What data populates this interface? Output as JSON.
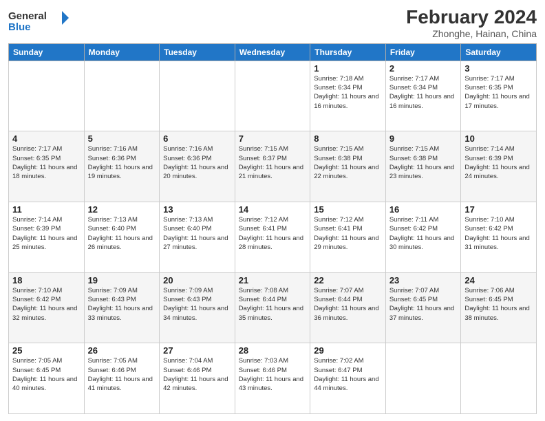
{
  "header": {
    "logo_general": "General",
    "logo_blue": "Blue",
    "title": "February 2024",
    "location": "Zhonghe, Hainan, China"
  },
  "days_of_week": [
    "Sunday",
    "Monday",
    "Tuesday",
    "Wednesday",
    "Thursday",
    "Friday",
    "Saturday"
  ],
  "weeks": [
    [
      {
        "day": "",
        "info": ""
      },
      {
        "day": "",
        "info": ""
      },
      {
        "day": "",
        "info": ""
      },
      {
        "day": "",
        "info": ""
      },
      {
        "day": "1",
        "info": "Sunrise: 7:18 AM\nSunset: 6:34 PM\nDaylight: 11 hours and 16 minutes."
      },
      {
        "day": "2",
        "info": "Sunrise: 7:17 AM\nSunset: 6:34 PM\nDaylight: 11 hours and 16 minutes."
      },
      {
        "day": "3",
        "info": "Sunrise: 7:17 AM\nSunset: 6:35 PM\nDaylight: 11 hours and 17 minutes."
      }
    ],
    [
      {
        "day": "4",
        "info": "Sunrise: 7:17 AM\nSunset: 6:35 PM\nDaylight: 11 hours and 18 minutes."
      },
      {
        "day": "5",
        "info": "Sunrise: 7:16 AM\nSunset: 6:36 PM\nDaylight: 11 hours and 19 minutes."
      },
      {
        "day": "6",
        "info": "Sunrise: 7:16 AM\nSunset: 6:36 PM\nDaylight: 11 hours and 20 minutes."
      },
      {
        "day": "7",
        "info": "Sunrise: 7:15 AM\nSunset: 6:37 PM\nDaylight: 11 hours and 21 minutes."
      },
      {
        "day": "8",
        "info": "Sunrise: 7:15 AM\nSunset: 6:38 PM\nDaylight: 11 hours and 22 minutes."
      },
      {
        "day": "9",
        "info": "Sunrise: 7:15 AM\nSunset: 6:38 PM\nDaylight: 11 hours and 23 minutes."
      },
      {
        "day": "10",
        "info": "Sunrise: 7:14 AM\nSunset: 6:39 PM\nDaylight: 11 hours and 24 minutes."
      }
    ],
    [
      {
        "day": "11",
        "info": "Sunrise: 7:14 AM\nSunset: 6:39 PM\nDaylight: 11 hours and 25 minutes."
      },
      {
        "day": "12",
        "info": "Sunrise: 7:13 AM\nSunset: 6:40 PM\nDaylight: 11 hours and 26 minutes."
      },
      {
        "day": "13",
        "info": "Sunrise: 7:13 AM\nSunset: 6:40 PM\nDaylight: 11 hours and 27 minutes."
      },
      {
        "day": "14",
        "info": "Sunrise: 7:12 AM\nSunset: 6:41 PM\nDaylight: 11 hours and 28 minutes."
      },
      {
        "day": "15",
        "info": "Sunrise: 7:12 AM\nSunset: 6:41 PM\nDaylight: 11 hours and 29 minutes."
      },
      {
        "day": "16",
        "info": "Sunrise: 7:11 AM\nSunset: 6:42 PM\nDaylight: 11 hours and 30 minutes."
      },
      {
        "day": "17",
        "info": "Sunrise: 7:10 AM\nSunset: 6:42 PM\nDaylight: 11 hours and 31 minutes."
      }
    ],
    [
      {
        "day": "18",
        "info": "Sunrise: 7:10 AM\nSunset: 6:42 PM\nDaylight: 11 hours and 32 minutes."
      },
      {
        "day": "19",
        "info": "Sunrise: 7:09 AM\nSunset: 6:43 PM\nDaylight: 11 hours and 33 minutes."
      },
      {
        "day": "20",
        "info": "Sunrise: 7:09 AM\nSunset: 6:43 PM\nDaylight: 11 hours and 34 minutes."
      },
      {
        "day": "21",
        "info": "Sunrise: 7:08 AM\nSunset: 6:44 PM\nDaylight: 11 hours and 35 minutes."
      },
      {
        "day": "22",
        "info": "Sunrise: 7:07 AM\nSunset: 6:44 PM\nDaylight: 11 hours and 36 minutes."
      },
      {
        "day": "23",
        "info": "Sunrise: 7:07 AM\nSunset: 6:45 PM\nDaylight: 11 hours and 37 minutes."
      },
      {
        "day": "24",
        "info": "Sunrise: 7:06 AM\nSunset: 6:45 PM\nDaylight: 11 hours and 38 minutes."
      }
    ],
    [
      {
        "day": "25",
        "info": "Sunrise: 7:05 AM\nSunset: 6:45 PM\nDaylight: 11 hours and 40 minutes."
      },
      {
        "day": "26",
        "info": "Sunrise: 7:05 AM\nSunset: 6:46 PM\nDaylight: 11 hours and 41 minutes."
      },
      {
        "day": "27",
        "info": "Sunrise: 7:04 AM\nSunset: 6:46 PM\nDaylight: 11 hours and 42 minutes."
      },
      {
        "day": "28",
        "info": "Sunrise: 7:03 AM\nSunset: 6:46 PM\nDaylight: 11 hours and 43 minutes."
      },
      {
        "day": "29",
        "info": "Sunrise: 7:02 AM\nSunset: 6:47 PM\nDaylight: 11 hours and 44 minutes."
      },
      {
        "day": "",
        "info": ""
      },
      {
        "day": "",
        "info": ""
      }
    ]
  ]
}
